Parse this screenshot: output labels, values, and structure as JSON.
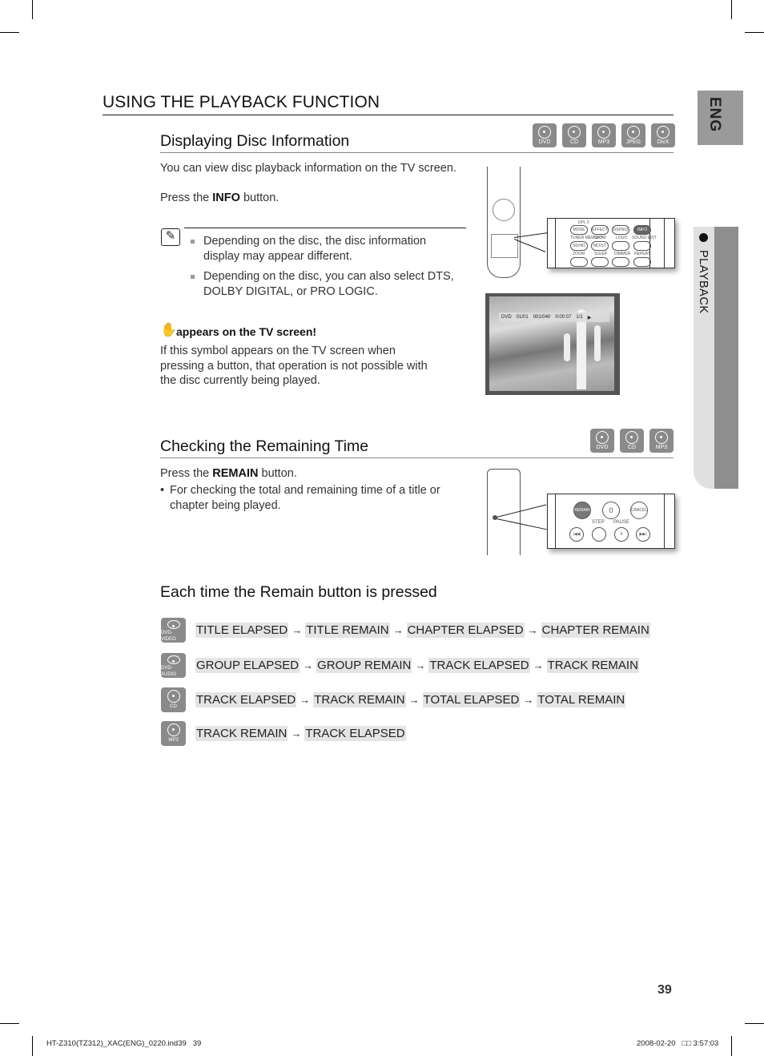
{
  "page": {
    "main_title": "USING THE PLAYBACK FUNCTION",
    "page_number": "39",
    "side_tab_language": "ENG",
    "side_tab_section": "PLAYBACK",
    "footer_left": "HT-Z310(TZ312)_XAC(ENG)_0220.ind39   39",
    "footer_right": "2008-02-20   □□ 3:57:03"
  },
  "section_disc_info": {
    "title": "Displaying Disc Information",
    "disc_badges": [
      "DVD",
      "CD",
      "MP3",
      "JPEG",
      "DivX"
    ],
    "intro": "You can view disc playback information  on the TV screen.",
    "press_prefix": "Press the ",
    "press_button": "INFO",
    "press_suffix": " button.",
    "notes": [
      "Depending on the disc, the disc information display may appear different.",
      "Depending on the disc, you can also select DTS, DOLBY DIGITAL, or PRO LOGIC."
    ],
    "hand_heading": "appears on the TV screen!",
    "hand_text": "If this symbol appears on the TV screen when pressing a button, that operation is not possible with the disc currently being played.",
    "remote_zoom": {
      "top_label": "DPL II",
      "rows": [
        [
          "MODE",
          "EFFECT",
          "DSP/EQ",
          "INFO"
        ],
        [
          "SD/HD",
          "MO/ST",
          "",
          ""
        ],
        [
          "",
          "",
          "",
          ""
        ]
      ],
      "row_labels": [
        [
          "",
          "",
          "",
          ""
        ],
        [
          "TUNER MEMORY",
          "SLOW",
          "LOGO",
          "SOUND EDIT"
        ],
        [
          "ZOOM",
          "SLEEP",
          "DIMMER",
          "REPEAT"
        ]
      ]
    },
    "tv_osd": {
      "disc": "DVD",
      "title": "01/01",
      "chapter": "001/040",
      "time": "0:00:07",
      "angle": "1/1"
    }
  },
  "section_remaining": {
    "title": "Checking the Remaining Time",
    "disc_badges": [
      "DVD",
      "CD",
      "MP3"
    ],
    "press_prefix": "Press the ",
    "press_button": "REMAIN",
    "press_suffix": " button.",
    "bullet": "For checking the total and remaining time of a title or chapter being played.",
    "remote_zoom": {
      "top_buttons": [
        "REMAIN",
        "0",
        "CANCEL"
      ],
      "labels": [
        "STEP",
        "PAUSE"
      ],
      "bottom_buttons": [
        "|◀◀",
        "",
        "II",
        "▶▶|"
      ]
    }
  },
  "section_each_time": {
    "title": "Each time the Remain button is pressed",
    "rows": [
      {
        "disc": "DVD-VIDEO",
        "steps": [
          "TITLE ELAPSED",
          "TITLE REMAIN",
          "CHAPTER ELAPSED",
          "CHAPTER REMAIN"
        ]
      },
      {
        "disc": "DVD-AUDIO",
        "steps": [
          "GROUP ELAPSED",
          "GROUP REMAIN",
          "TRACK ELAPSED",
          "TRACK REMAIN"
        ]
      },
      {
        "disc": "CD",
        "steps": [
          "TRACK ELAPSED",
          "TRACK REMAIN",
          "TOTAL ELAPSED",
          "TOTAL REMAIN"
        ]
      },
      {
        "disc": "MP3",
        "steps": [
          "TRACK REMAIN",
          "TRACK ELAPSED"
        ]
      }
    ],
    "arrow": "→"
  }
}
